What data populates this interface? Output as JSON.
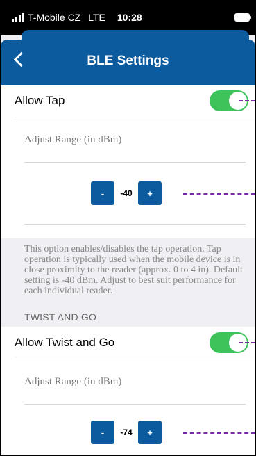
{
  "status_bar": {
    "carrier": "T-Mobile CZ",
    "network": "LTE",
    "time": "10:28"
  },
  "nav": {
    "title": "BLE Settings"
  },
  "tap_section": {
    "toggle_label": "Allow Tap",
    "toggle_on": true,
    "range_label": "Adjust Range (in dBm)",
    "decrement": "-",
    "value": "-40",
    "increment": "+",
    "footer": "This option enables/disables the tap operation. Tap operation is typically used when the mobile device is in close proximity to the reader (approx. 0 to 4 in). Default setting is -40 dBm. Adjust to best suit performance for each individual reader."
  },
  "twist_section": {
    "header": "TWIST AND GO",
    "toggle_label": "Allow Twist and Go",
    "toggle_on": true,
    "range_label": "Adjust Range (in dBm)",
    "decrement": "-",
    "value": "-74",
    "increment": "+"
  },
  "colors": {
    "accent": "#0c5b9e",
    "toggle_on": "#3ec35b",
    "annotation": "#7a2aa8"
  }
}
